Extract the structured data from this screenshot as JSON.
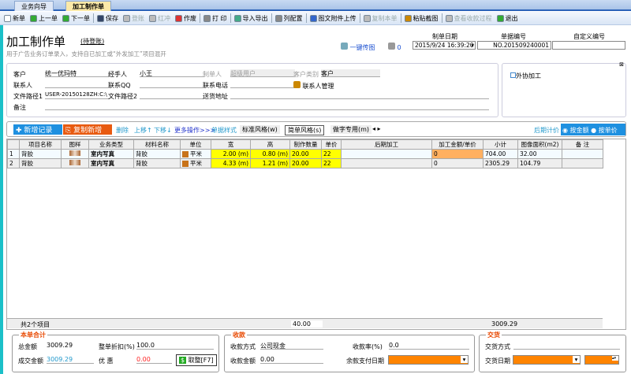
{
  "tabs": [
    {
      "label": "业务向导"
    },
    {
      "label": "加工制作单"
    }
  ],
  "toolbar": [
    "新单",
    "上一单",
    "下一单",
    "保存",
    "登账",
    "红冲",
    "作废",
    "打 印",
    "导入导出",
    "列配置",
    "图文附件上传",
    "复制本单",
    "粘贴截图",
    "查看收款过程",
    "退出"
  ],
  "header": {
    "title": "加工制作单",
    "status": "(待登账)",
    "subtitle": "用于广告业务订单录入，支持自已加工或“外发加工”项目混开",
    "send_image": "一键传图",
    "print_count": "0",
    "date_label": "制单日期",
    "date_value": "2015/9/24 16:39:20",
    "number_label": "单据编号",
    "number_value": "NO.201509240001",
    "custom_label": "自定义编号",
    "custom_value": ""
  },
  "form": {
    "customer_label": "客户",
    "customer": "统一优玛特",
    "handler_label": "经手人",
    "handler": "小王",
    "maker_label": "制单人",
    "maker": "超级用户",
    "ctype_label": "客户类别",
    "ctype": "客户",
    "contact_label": "联系人",
    "contact": "",
    "qq_label": "联系QQ",
    "qq": "",
    "phone_label": "联系电话",
    "phone": "",
    "contact_mgr": "联系人管理",
    "path1_label": "文件路径1",
    "path1": "USER-20150128ZH:C:\\",
    "path2_label": "文件路径2",
    "path2": "",
    "addr_label": "送货地址",
    "addr": "",
    "note_label": "备注",
    "note": "",
    "outsource": "外协加工"
  },
  "actions": {
    "add": "新增记录",
    "copy": "复制新增",
    "delete": "删除",
    "up": "上移↑",
    "down": "下移↓",
    "more": "更多操作>>>",
    "style": "单据样式",
    "styles": [
      "标准风格(w)",
      "简单风格(s)",
      "做字专用(m)"
    ],
    "pricing": "后期计价",
    "by_amount": "按金额",
    "by_unit": "按单价"
  },
  "grid": {
    "columns": [
      "",
      "项目名称",
      "图样",
      "业务类型",
      "材料名称",
      "单位",
      "宽",
      "高",
      "制作数量",
      "单价",
      "后期加工",
      "加工金额/单价",
      "小计",
      "图像面积(m2)",
      "备 注"
    ],
    "rows": [
      [
        "1",
        "背胶",
        "",
        "室内写真",
        "背胶",
        "平米",
        "2.00 (m)",
        "0.80 (m)",
        "20.00",
        "22",
        "",
        "0",
        "704.00",
        "32.00",
        ""
      ],
      [
        "2",
        "背胶",
        "",
        "室内写真",
        "背胶",
        "平米",
        "4.33 (m)",
        "1.21 (m)",
        "20.00",
        "22",
        "",
        "0",
        "2305.29",
        "104.79",
        ""
      ]
    ],
    "footer_count": "共2个项目",
    "footer_qty": "40.00",
    "footer_subtotal": "3009.29"
  },
  "totals": {
    "title": "本单合计",
    "total_label": "总金额",
    "total": "3009.29",
    "discount_label": "整单折扣(%)",
    "discount": "100.0",
    "deal_label": "成交金额",
    "deal": "3009.29",
    "promo_label": "优 惠",
    "promo": "0.00",
    "round_btn": "取整[F7]"
  },
  "payment": {
    "title": "收款",
    "method_label": "收款方式",
    "method": "公司现金",
    "rate_label": "收款率(%)",
    "rate": "0.0",
    "amount_label": "收款金额",
    "amount": "0.00",
    "due_label": "余款支付日期"
  },
  "delivery": {
    "title": "交货",
    "method_label": "交货方式",
    "date_label": "交货日期"
  },
  "colors": {
    "accent": "#1e90e0",
    "copy_btn": "#e85a10",
    "highlight": "#ffff00",
    "orange": "#ff8400"
  }
}
